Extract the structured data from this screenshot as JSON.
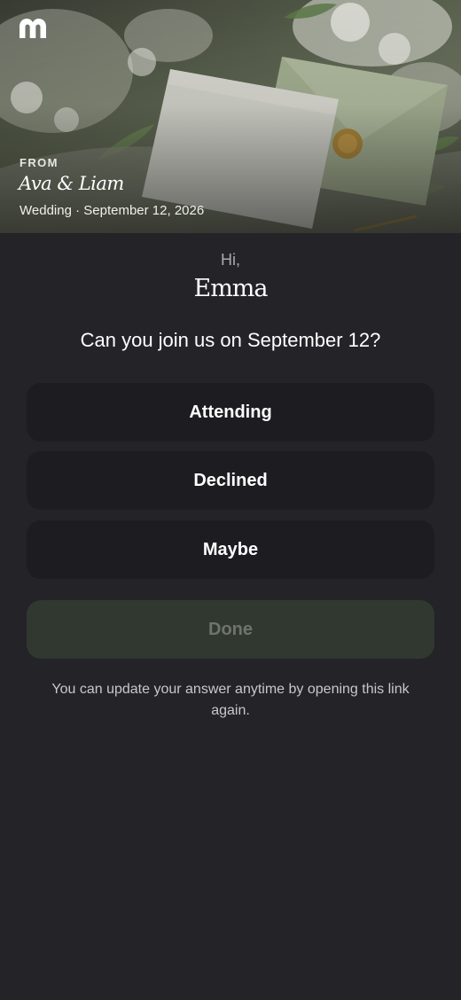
{
  "header": {
    "logo_icon": "m-logo-icon",
    "from_label": "FROM",
    "hosts": "Ava & Liam",
    "event_line": "Wedding · September 12, 2026"
  },
  "rsvp": {
    "greeting": "Hi,",
    "guest_name": "Emma",
    "question": "Can you join us on September 12?",
    "options": [
      {
        "label": "Attending"
      },
      {
        "label": "Declined"
      },
      {
        "label": "Maybe"
      }
    ],
    "done_label": "Done",
    "note": "You can update your answer anytime by opening this link again."
  },
  "colors": {
    "background": "#232328",
    "option_bg": "#1c1c21",
    "done_bg": "#313830",
    "done_text": "#6f746d"
  }
}
